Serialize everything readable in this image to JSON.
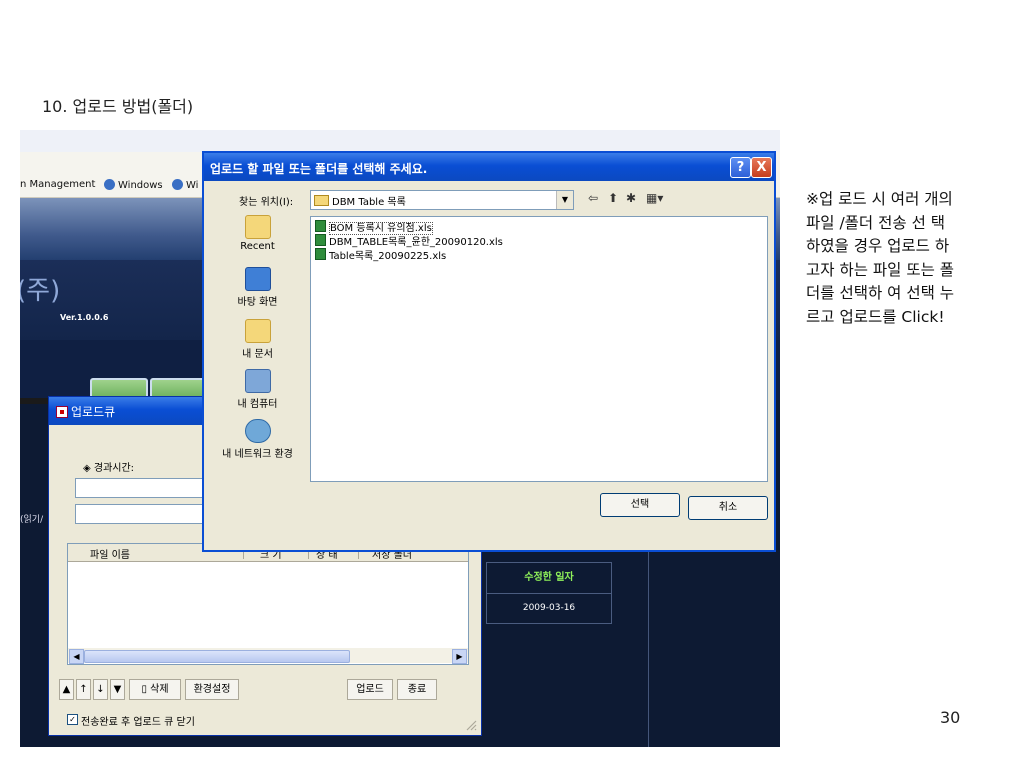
{
  "slide": {
    "title": "10. 업로드 방법(폴더)",
    "note": "※업 로드 시 여러 개의 파일 /폴더 전송 선 택 하였을 경우 업로드 하고자 하는 파일 또는 폴더를 선택하 여 선택 누르고 업로드를 Click!",
    "page_number": "30"
  },
  "background_app": {
    "links_text": "n Management",
    "link2": "Windows",
    "link3": "Wi",
    "logo": "(주)",
    "version": "Ver.1.0.0.6",
    "left_label": "(읽기/",
    "table_header": "수정한 일자",
    "table_cell": "2009-03-16"
  },
  "upload_queue": {
    "title": "업로드큐",
    "elapsed_label": "◈ 경과시간:",
    "columns": [
      "파일 이름",
      "크 기",
      "상 태",
      "저장 폴더"
    ],
    "buttons": {
      "delete": "삭제",
      "settings": "환경설정",
      "upload": "업로드",
      "exit": "종료"
    },
    "toolbar_icons": [
      "▲",
      "↑",
      "↓",
      "▼",
      "🗑"
    ],
    "checkbox_label": "전송완료 후 업로드 큐 닫기",
    "checkbox_checked": true
  },
  "open_dialog": {
    "title": "업로드 할 파일 또는 폴더를 선택해 주세요.",
    "help": "?",
    "close": "X",
    "lookin_label": "찾는 위치(I):",
    "lookin_value": "DBM Table 목록",
    "places": [
      "Recent",
      "바탕 화면",
      "내 문서",
      "내 컴퓨터",
      "내 네트워크 환경"
    ],
    "files": [
      "BOM 등록시 유의점.xls",
      "DBM_TABLE목록_윤한_20090120.xls",
      "Table목록_20090225.xls"
    ],
    "select_button": "선택",
    "cancel_button": "취소"
  },
  "colors": {
    "xp_titlebar": "#0a4ed4",
    "xp_face": "#ece9d8",
    "app_dark": "#0d1a33",
    "table_header_text": "#8ff05a"
  }
}
